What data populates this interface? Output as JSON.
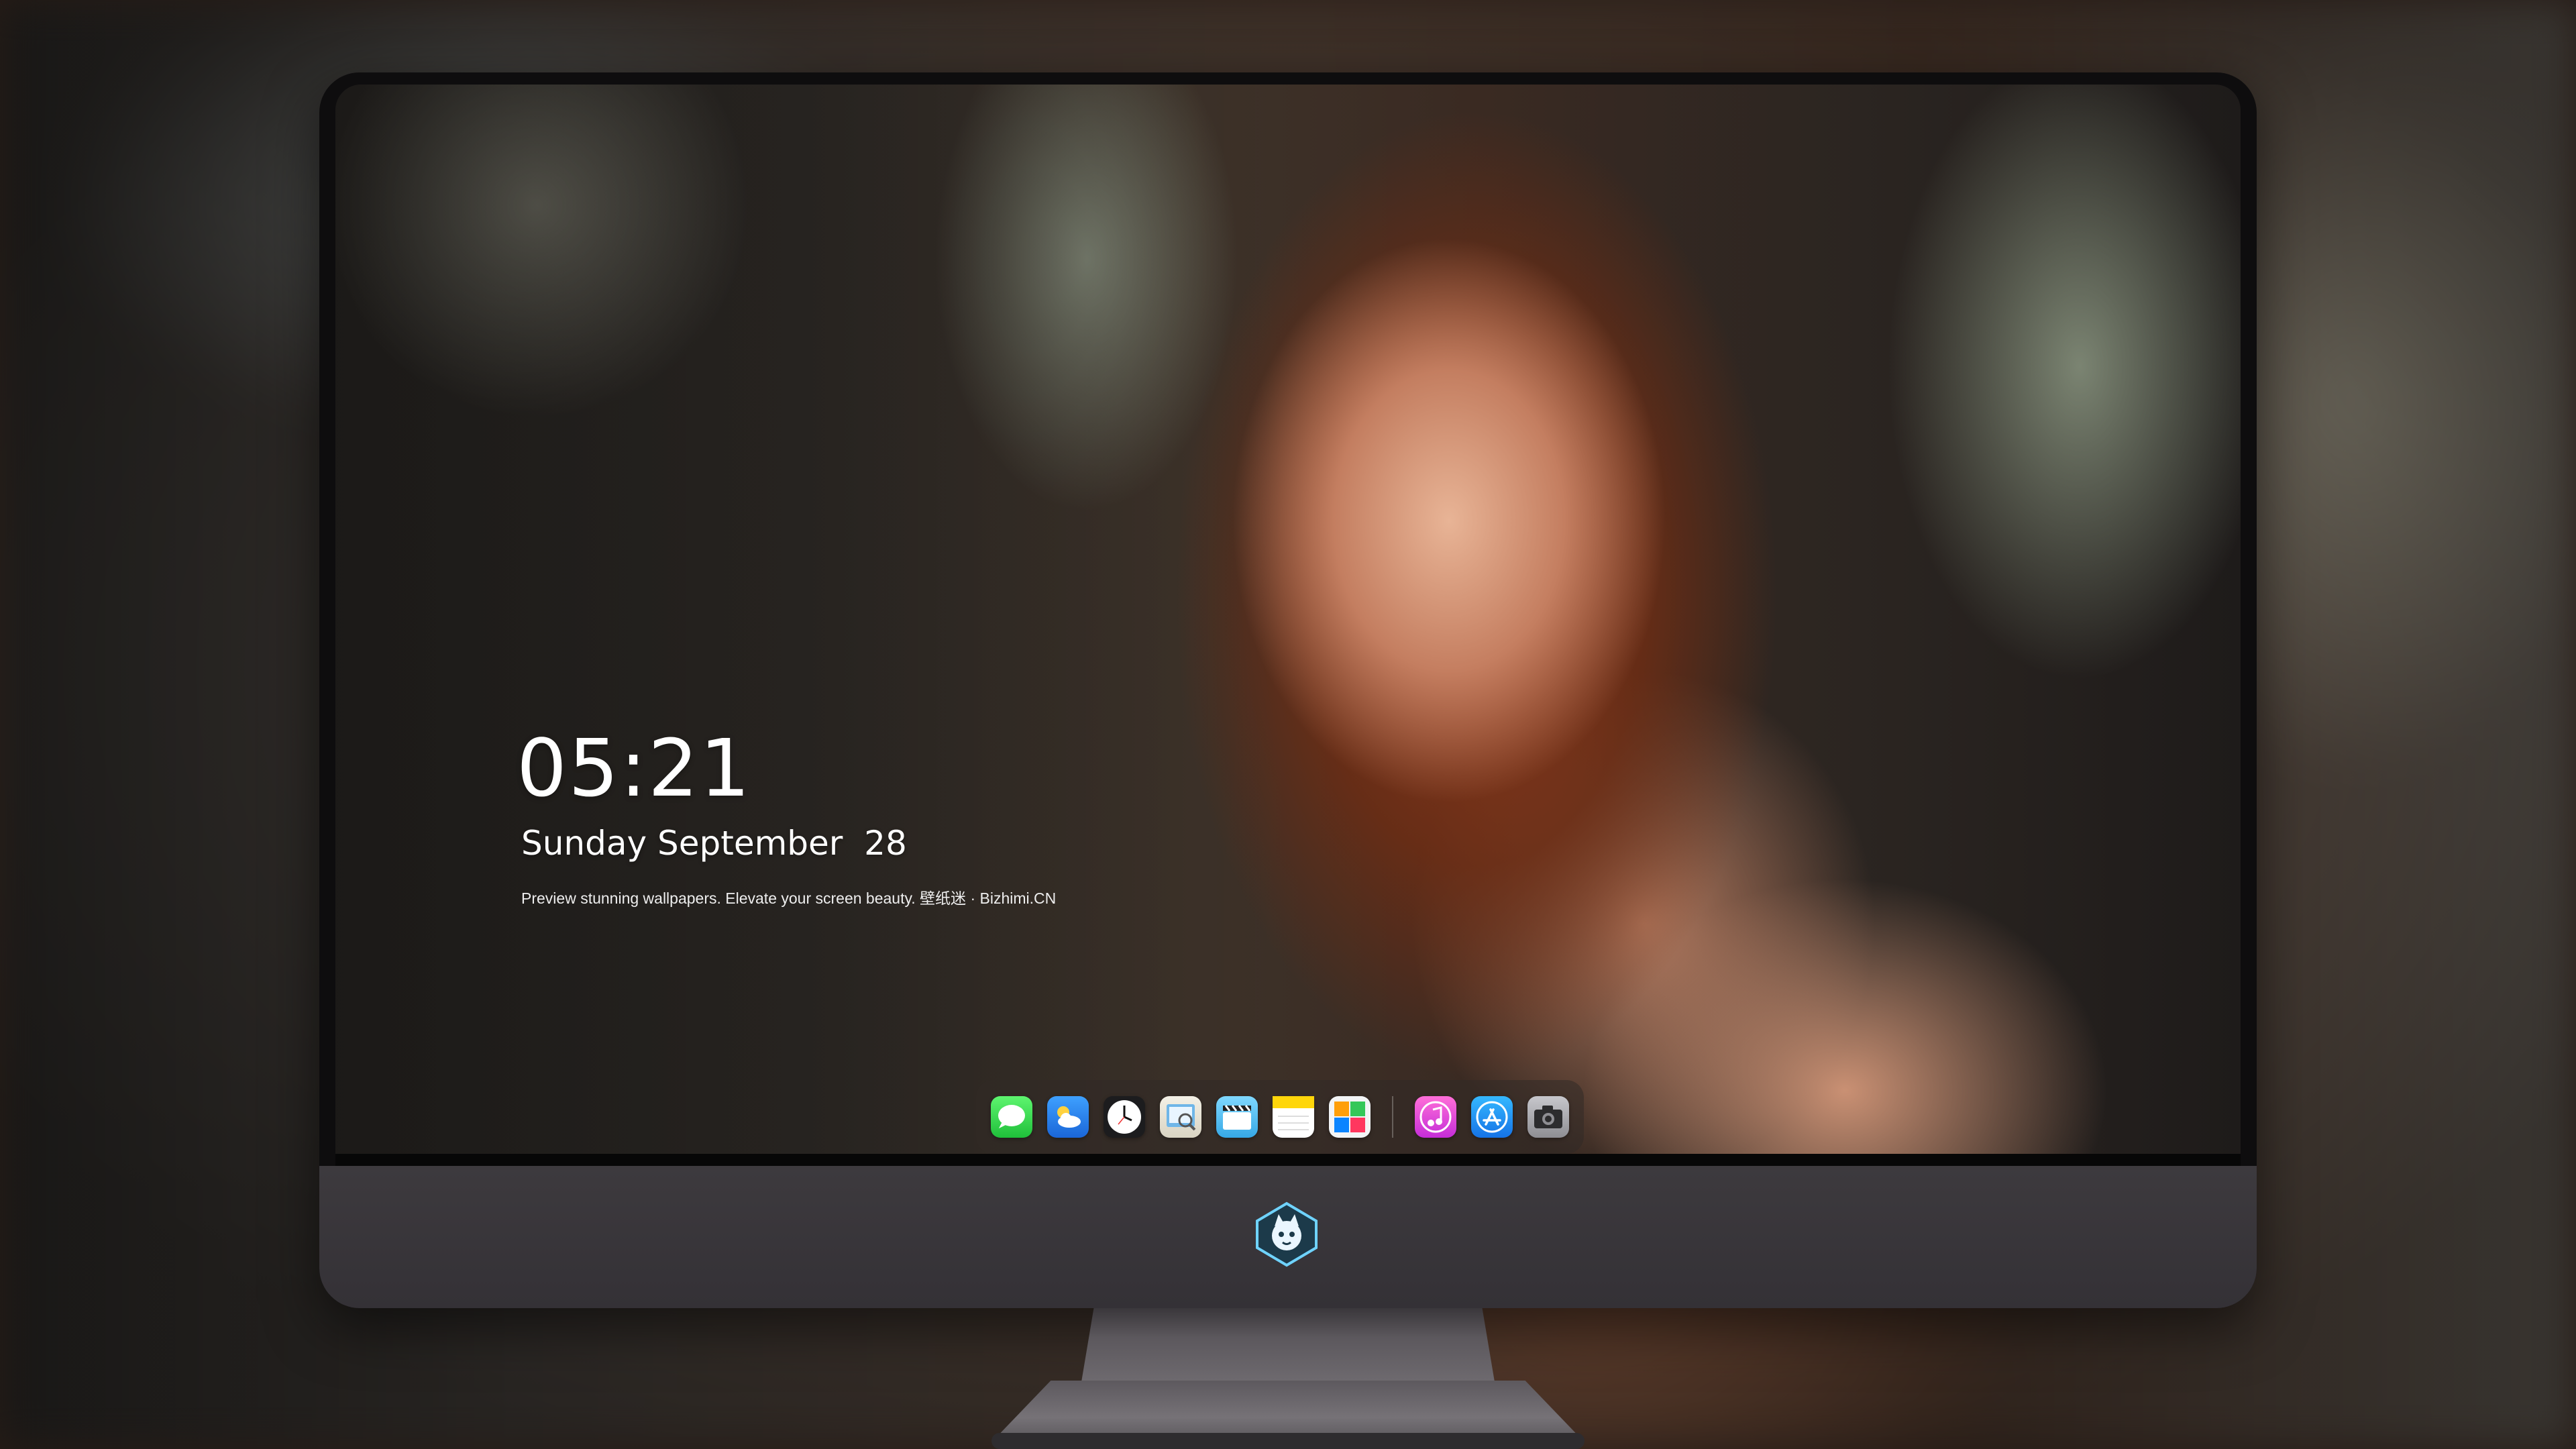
{
  "lock_screen": {
    "time": "05:21",
    "date": "Sunday September  28",
    "tagline": "Preview stunning wallpapers. Elevate your screen beauty. 壁纸迷 · Bizhimi.CN"
  },
  "dock": {
    "apps": [
      {
        "name": "messages-icon",
        "color": "#34c759"
      },
      {
        "name": "weather-icon",
        "color": "#2f86ee"
      },
      {
        "name": "clock-icon",
        "color": "#1c1c1e"
      },
      {
        "name": "preview-icon",
        "color": "#e9d36a"
      },
      {
        "name": "clips-icon",
        "color": "#5ac8fa"
      },
      {
        "name": "notes-icon",
        "color": "#ffd60a"
      },
      {
        "name": "photo-booth-icon",
        "color": "#e8eef2"
      },
      {
        "name": "music-icon",
        "color": "#fc3c8f"
      },
      {
        "name": "app-store-icon",
        "color": "#1c8cf5"
      },
      {
        "name": "camera-icon",
        "color": "#8e8e93"
      }
    ]
  },
  "brand_logo": "bizhimi-logo"
}
